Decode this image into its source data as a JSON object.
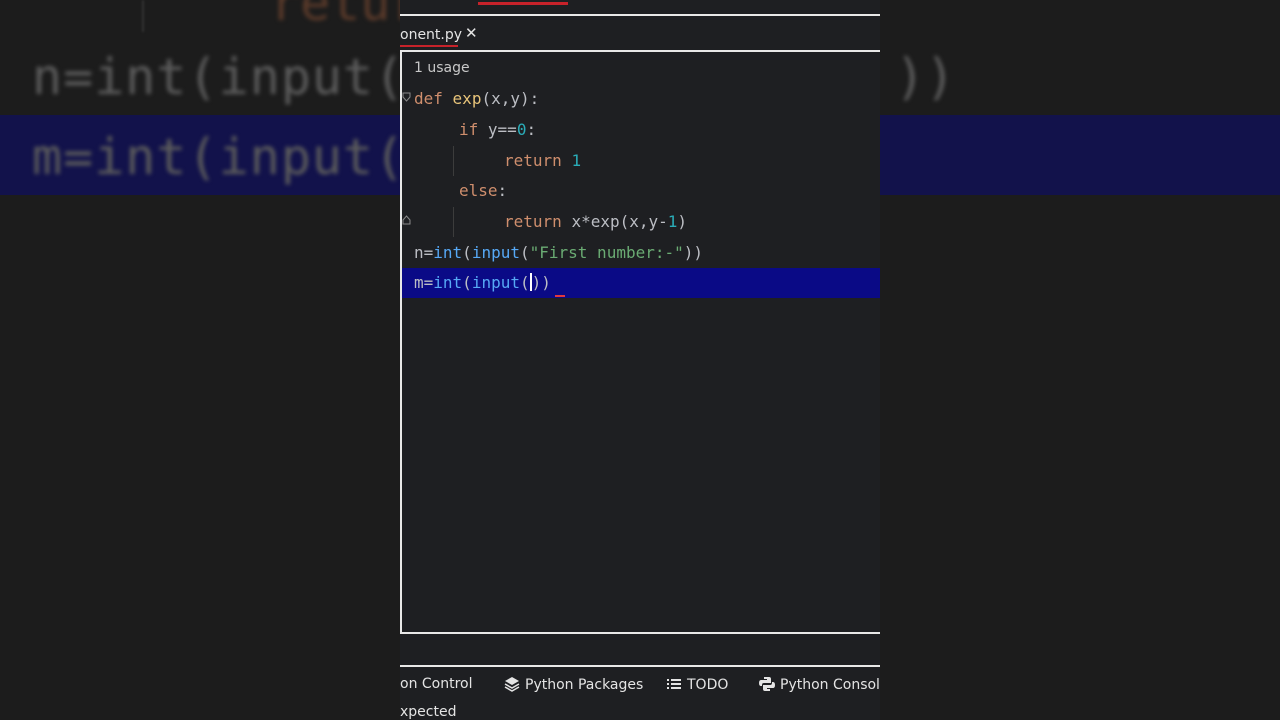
{
  "background": {
    "line_n": "n=int(input(\"",
    "line_m": "m=int(input(",
    "paren_tail": "))",
    "ret_fragment": "retur"
  },
  "tab": {
    "label": "onent.py",
    "close": "✕"
  },
  "usage": "1 usage",
  "code": {
    "l1": {
      "kw": "def",
      "name": "exp",
      "rest": "(x,y):"
    },
    "l2": {
      "kw": "if",
      "rest": "y==",
      "num": "0",
      "end": ":"
    },
    "l3": {
      "kw": "return",
      "num": "1"
    },
    "l4": {
      "kw": "else",
      "end": ":"
    },
    "l5": {
      "kw": "return",
      "pre": "x*exp(x,y-",
      "num": "1",
      "end": ")"
    },
    "l6": {
      "a": "n=",
      "fn1": "int",
      "b": "(",
      "fn2": "input",
      "c": "(",
      "str": "\"First number:-\"",
      "d": "))"
    },
    "l7": {
      "a": "m=",
      "fn1": "int",
      "b": "(",
      "fn2": "input",
      "c": "(",
      "after": "))"
    }
  },
  "toolwindows": {
    "version_control": "on Control",
    "python_packages": "Python Packages",
    "todo": "TODO",
    "python_console": "Python Console"
  },
  "status": "xpected",
  "colors": {
    "keyword": "#cf8e6d",
    "function": "#56a8f5",
    "number": "#2aacb8",
    "string": "#6aab73",
    "current_line": "#0a0a86"
  }
}
